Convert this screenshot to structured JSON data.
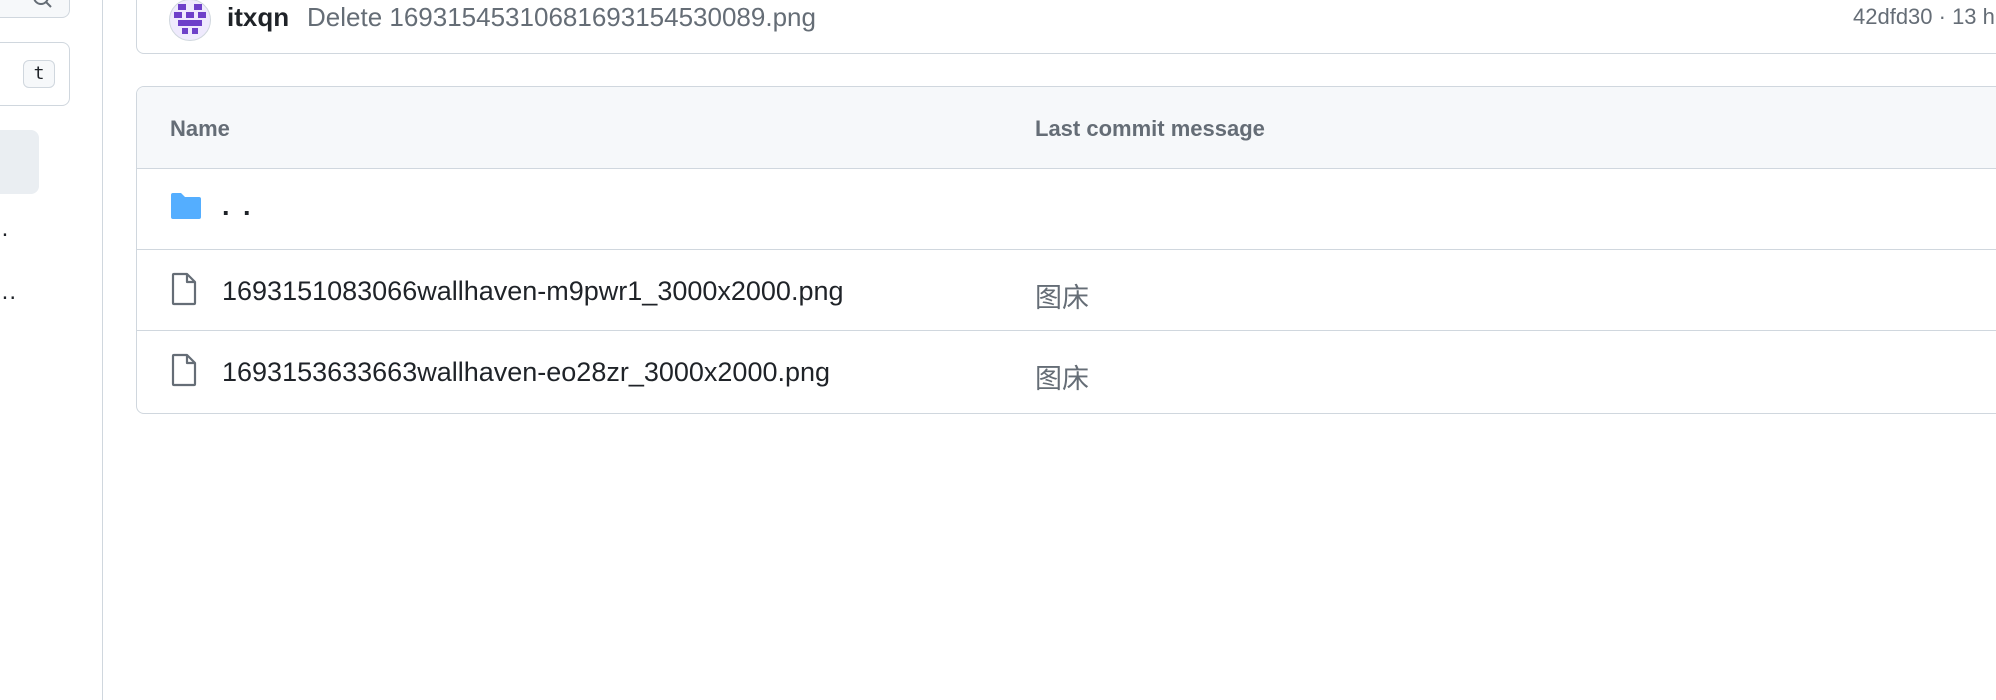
{
  "sidebar": {
    "filter_shortcut_key": "t",
    "items": [
      {
        "label": ".."
      },
      {
        "label": "..."
      }
    ]
  },
  "latest_commit": {
    "author": "itxqn",
    "message": "Delete 16931545310681693154530089.png",
    "hash_and_time": "42dfd30 · 13 h"
  },
  "file_table": {
    "columns": {
      "name": "Name",
      "last_commit_message": "Last commit message"
    },
    "parent_row": {
      "name": ". .",
      "icon": "folder-icon"
    },
    "rows": [
      {
        "name": "1693151083066wallhaven-m9pwr1_3000x2000.png",
        "message": "图床",
        "icon": "file-icon"
      },
      {
        "name": "1693153633663wallhaven-eo28zr_3000x2000.png",
        "message": "图床",
        "icon": "file-icon"
      }
    ]
  },
  "colors": {
    "folder": "#54aeff",
    "border": "#d0d7de",
    "muted_text": "#656d76",
    "header_bg": "#f6f8fa"
  }
}
